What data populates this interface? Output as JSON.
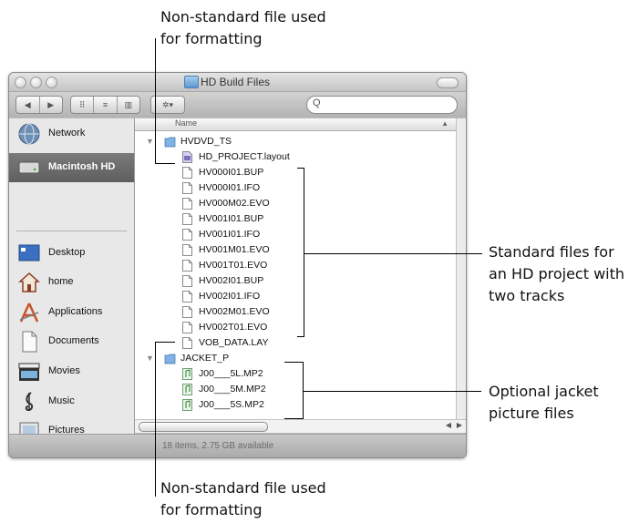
{
  "callouts": {
    "top": {
      "line1": "Non-standard file used",
      "line2": "for formatting"
    },
    "bottom": {
      "line1": "Non-standard file used",
      "line2": "for formatting"
    },
    "standard": {
      "line1": "Standard files for",
      "line2": "an HD project with",
      "line3": "two tracks"
    },
    "jacket": {
      "line1": "Optional jacket",
      "line2": "picture files"
    }
  },
  "window": {
    "title": "HD Build Files",
    "search_placeholder": "",
    "column_name": "Name",
    "status": "18 items, 2.75 GB available"
  },
  "toolbar": {
    "back_glyph": "◀",
    "forward_glyph": "▶",
    "icon_view_glyph": "⠿",
    "list_view_glyph": "≡",
    "column_view_glyph": "▥",
    "action_glyph": "✲▾",
    "search_glyph": "Q"
  },
  "sidebar": {
    "items": [
      {
        "label": "Network",
        "icon": "network-icon"
      },
      {
        "label": "Macintosh HD",
        "icon": "hard-drive-icon"
      },
      {
        "label": "Desktop",
        "icon": "desktop-icon"
      },
      {
        "label": "home",
        "icon": "home-icon"
      },
      {
        "label": "Applications",
        "icon": "applications-icon"
      },
      {
        "label": "Documents",
        "icon": "documents-icon"
      },
      {
        "label": "Movies",
        "icon": "movies-icon"
      },
      {
        "label": "Music",
        "icon": "music-icon"
      },
      {
        "label": "Pictures",
        "icon": "pictures-icon"
      }
    ]
  },
  "files": {
    "folder1": "HVDVD_TS",
    "layout": "HD_PROJECT.layout",
    "hvdvd_files": [
      "HV000I01.BUP",
      "HV000I01.IFO",
      "HV000M02.EVO",
      "HV001I01.BUP",
      "HV001I01.IFO",
      "HV001M01.EVO",
      "HV001T01.EVO",
      "HV002I01.BUP",
      "HV002I01.IFO",
      "HV002M01.EVO",
      "HV002T01.EVO"
    ],
    "vob": "VOB_DATA.LAY",
    "folder2": "JACKET_P",
    "jacket_files": [
      "J00___5L.MP2",
      "J00___5M.MP2",
      "J00___5S.MP2"
    ]
  },
  "disclosure_glyph": "▼",
  "sort_arrow": "▲"
}
